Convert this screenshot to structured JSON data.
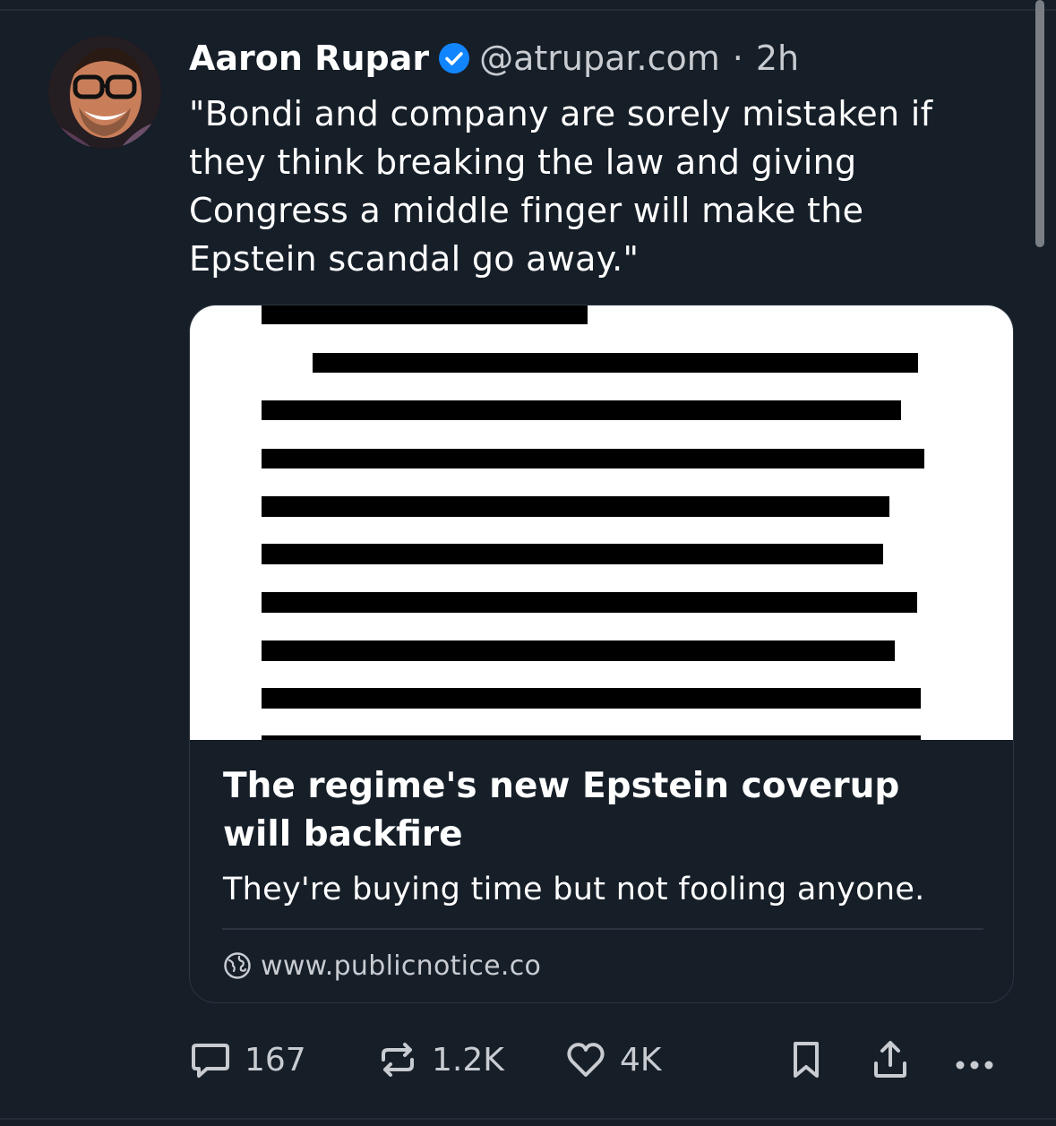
{
  "post": {
    "author_name": "Aaron Rupar",
    "handle": "@atrupar.com",
    "separator": "·",
    "time": "2h",
    "text": "\"Bondi and company are sorely mistaken if they think breaking the law and giving Congress a middle finger will make the Epstein scandal go away.\""
  },
  "card": {
    "title": "The regime's new Epstein coverup will backfire",
    "description": "They're buying time but not fooling anyone.",
    "domain": "www.publicnotice.co",
    "image_icon": "redacted-document"
  },
  "actions": {
    "replies": "167",
    "reposts": "1.2K",
    "likes": "4K"
  },
  "colors": {
    "background": "#161e28",
    "verified": "#1185fe",
    "muted_text": "#c8ccd1"
  }
}
